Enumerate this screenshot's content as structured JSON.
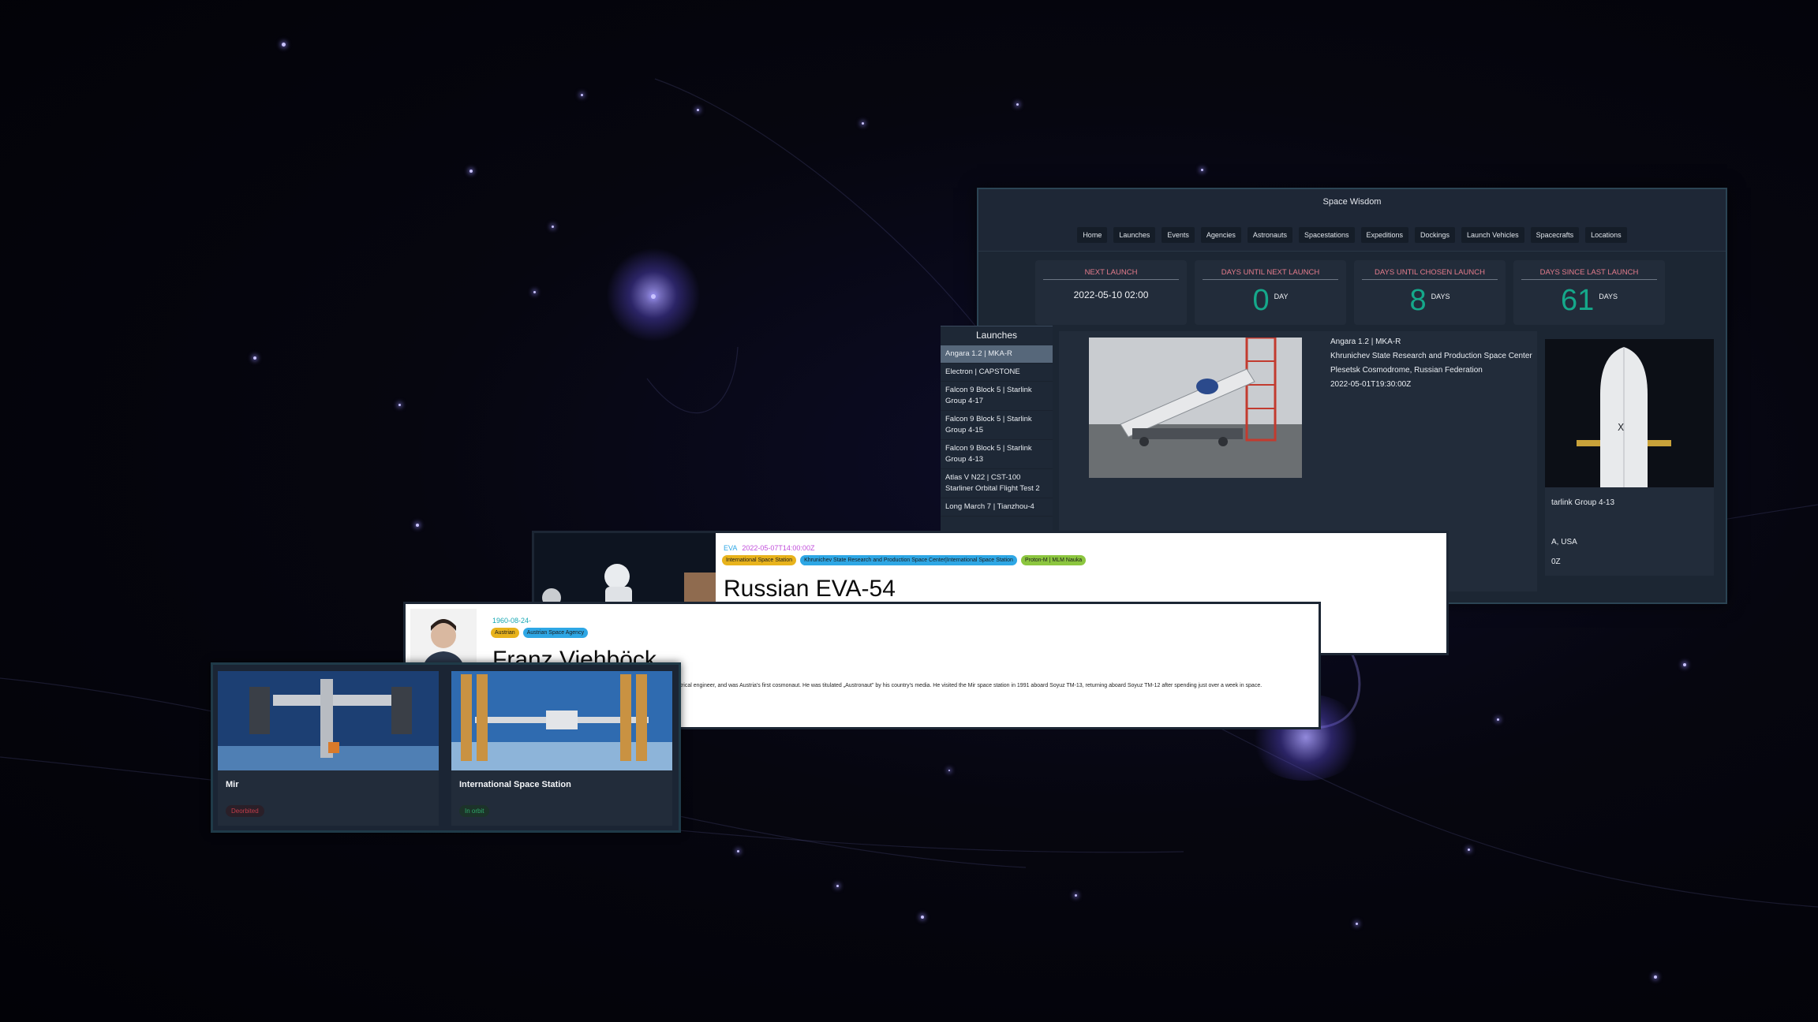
{
  "app": {
    "title": "Space Wisdom",
    "nav": [
      "Home",
      "Launches",
      "Events",
      "Agencies",
      "Astronauts",
      "Spacestations",
      "Expeditions",
      "Dockings",
      "Launch Vehicles",
      "Spacecrafts",
      "Locations"
    ]
  },
  "stats": {
    "next_launch": {
      "title": "NEXT LAUNCH",
      "value": "2022-05-10 02:00"
    },
    "days_until_next": {
      "title": "DAYS UNTIL NEXT LAUNCH",
      "value": "0",
      "unit": "DAY"
    },
    "days_until_chosen": {
      "title": "DAYS UNTIL CHOSEN LAUNCH",
      "value": "8",
      "unit": "DAYS"
    },
    "days_since_last": {
      "title": "DAYS SINCE LAST LAUNCH",
      "value": "61",
      "unit": "DAYS"
    }
  },
  "launches": {
    "title": "Launches",
    "items": [
      "Angara 1.2 | MKA-R",
      "Electron | CAPSTONE",
      "Falcon 9 Block 5 | Starlink Group 4-17",
      "Falcon 9 Block 5 | Starlink Group 4-15",
      "Falcon 9 Block 5 | Starlink Group 4-13",
      "Atlas V N22 | CST-100 Starliner Orbital Flight Test 2",
      "Long March 7 | Tianzhou-4"
    ]
  },
  "selected_launch": {
    "name": "Angara 1.2 | MKA-R",
    "agency": "Khrunichev State Research and Production Space Center",
    "location": "Plesetsk Cosmodrome, Russian Federation",
    "date": "2022-05-01T19:30:00Z"
  },
  "right_card": {
    "line1": "tarlink Group 4-13",
    "line2": "A, USA",
    "line3": "0Z"
  },
  "event": {
    "type": "EVA",
    "date": "2022-05-07T14:00:00Z",
    "tags": [
      "International Space Station",
      "Khrunichev State Research and Production Space Center|International Space Station",
      "Proton-M | MLM Nauka"
    ],
    "title": "Russian EVA-54"
  },
  "astronaut": {
    "birth": "1960-08-24-",
    "tags": [
      "Austrian",
      "Austrian Space Agency"
    ],
    "name": "Franz Viehböck",
    "bio": "trical engineer, and was Austria's first cosmonaut. He was titulated „Austronaut\" by his country's media. He visited the Mir space station in 1991 aboard Soyuz TM-13, returning aboard Soyuz TM-12 after spending just over a week in space."
  },
  "stations": [
    {
      "name": "Mir",
      "status": "Deorbited",
      "status_color": "#c23d4a"
    },
    {
      "name": "International Space Station",
      "status": "In orbit",
      "status_color": "#2fa86a"
    }
  ],
  "colors": {
    "accent_teal": "#15a88a",
    "stat_title": "#e57c8c",
    "tag_yellow": "#e8b31c",
    "tag_blue": "#2ea7e5",
    "tag_green": "#8cc63f"
  }
}
